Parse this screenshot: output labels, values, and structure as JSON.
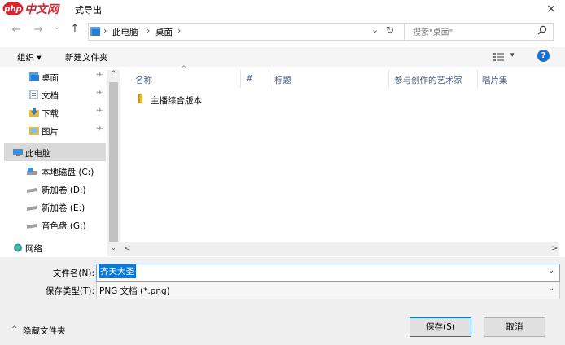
{
  "title_bar": {
    "logo_text": "php中文网",
    "title": "式导出",
    "close_glyph": "×"
  },
  "nav_bar": {
    "back_glyph": "←",
    "forward_glyph": "→",
    "dropdown_glyph": "⌄",
    "up_glyph": "↑",
    "breadcrumb": [
      "此电脑",
      "桌面"
    ],
    "breadcrumb_sep": "›",
    "breadcrumb_dropdown": "⌄",
    "refresh_glyph": "↻",
    "search_placeholder": "搜索\"桌面\""
  },
  "toolbar": {
    "organize_label": "组织 ▾",
    "new_folder_label": "新建文件夹",
    "view_glyph": "▾",
    "help_glyph": "?"
  },
  "nav_pane": {
    "items": [
      {
        "label": "桌面",
        "icon": "desktop-folder-icon",
        "pinned": true
      },
      {
        "label": "文档",
        "icon": "documents-folder-icon",
        "pinned": true
      },
      {
        "label": "下载",
        "icon": "downloads-folder-icon",
        "pinned": true
      },
      {
        "label": "图片",
        "icon": "pictures-folder-icon",
        "pinned": true
      },
      {
        "label": "此电脑",
        "icon": "computer-icon",
        "pinned": false,
        "selected": true
      },
      {
        "label": "本地磁盘 (C:)",
        "icon": "local-disk-icon",
        "pinned": false
      },
      {
        "label": "新加卷 (D:)",
        "icon": "drive-icon",
        "pinned": false
      },
      {
        "label": "新加卷 (E:)",
        "icon": "drive-icon",
        "pinned": false
      },
      {
        "label": "音色盘 (G:)",
        "icon": "drive-icon",
        "pinned": false
      },
      {
        "label": "网络",
        "icon": "network-icon",
        "pinned": false
      }
    ],
    "pin_glyph": "✈",
    "scroll_up": "^",
    "scroll_down": "⌄"
  },
  "file_list": {
    "sort_indicator": "^",
    "columns": [
      "名称",
      "#",
      "标题",
      "参与创作的艺术家",
      "唱片集"
    ],
    "rows": [
      {
        "name": "主播综合版本",
        "icon": "folder-icon"
      }
    ],
    "hscroll_left": "<",
    "hscroll_right": ">"
  },
  "bottom": {
    "filename_label": "文件名(N):",
    "filename_value": "齐天大圣",
    "filetype_label": "保存类型(T):",
    "filetype_value": "PNG 文档 (*.png)",
    "dropdown_glyph": "⌄",
    "hide_folders_label": "隐藏文件夹",
    "hide_folders_glyph": "^",
    "save_label": "保存(S)",
    "cancel_label": "取消"
  },
  "colors": {
    "accent": "#0a78d7",
    "folder": "#e8b93a",
    "column_header": "#4d6082",
    "help_circle": "#1c6fd1"
  }
}
